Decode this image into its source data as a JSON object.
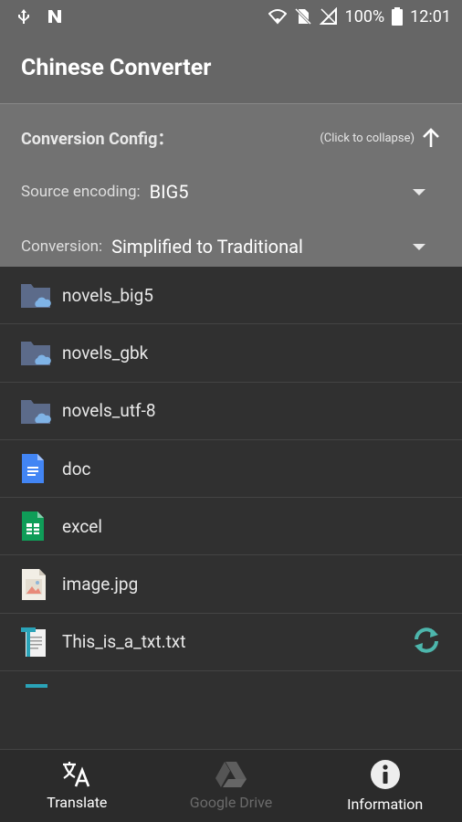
{
  "status": {
    "battery": "100%",
    "time": "12:01",
    "icons": [
      "usb-icon",
      "notification-icon",
      "wifi-icon",
      "no-sim-icon",
      "signal-icon",
      "battery-icon"
    ]
  },
  "app": {
    "title": "Chinese Converter"
  },
  "config": {
    "title": "Conversion Config：",
    "collapse_hint": "(Click to collapse)",
    "source_label": "Source encoding:",
    "source_value": "BIG5",
    "conversion_label": "Conversion:",
    "conversion_value": "Simplified to Traditional"
  },
  "files": [
    {
      "name": "novels_big5",
      "icon": "cloud-folder-icon"
    },
    {
      "name": "novels_gbk",
      "icon": "cloud-folder-icon"
    },
    {
      "name": "novels_utf-8",
      "icon": "cloud-folder-icon"
    },
    {
      "name": "doc",
      "icon": "google-doc-icon"
    },
    {
      "name": "excel",
      "icon": "google-sheet-icon"
    },
    {
      "name": "image.jpg",
      "icon": "image-file-icon"
    },
    {
      "name": "This_is_a_txt.txt",
      "icon": "text-file-icon",
      "action": "convert-icon"
    }
  ],
  "nav": {
    "translate": "Translate",
    "drive": "Google Drive",
    "info": "Information"
  },
  "colors": {
    "accent": "#4db6ac",
    "folder": "#5c6b8a",
    "doc": "#4285f4",
    "sheet": "#0f9d58"
  }
}
